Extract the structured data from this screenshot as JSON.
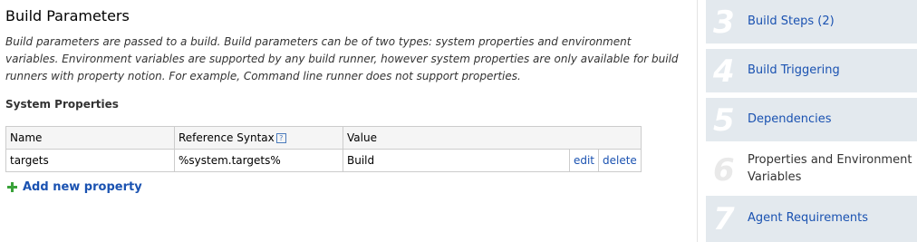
{
  "build_parameters": {
    "title": "Build Parameters",
    "description": "Build parameters are passed to a build. Build parameters can be of two types: system properties and environment variables. Environment variables are supported by any build runner, however system properties are only available for build runners with property notion. For example, Command line runner does not support properties.",
    "desc_lines": [
      "Build parameters are passed to a build. Build parameters can be of two types: system properties and environment",
      "variables. Environment variables are supported by any build runner, however system properties are only available for build",
      "runners with property notion. For example, Command line runner does not support properties."
    ]
  },
  "system_properties": {
    "title": "System Properties",
    "columns": {
      "name": "Name",
      "reference": "Reference Syntax",
      "value": "Value"
    },
    "help_icon": "help-icon",
    "rows": [
      {
        "name": "targets",
        "reference": "%system.targets%",
        "value": "Build",
        "edit": "edit",
        "delete": "delete"
      }
    ],
    "add_label": "Add new property",
    "add_icon": "plus-icon"
  },
  "steps": [
    {
      "number": "3",
      "label": "Build Steps (2)",
      "current": false
    },
    {
      "number": "4",
      "label": "Build Triggering",
      "current": false
    },
    {
      "number": "5",
      "label": "Dependencies",
      "current": false
    },
    {
      "number": "6",
      "label_lines": [
        "Properties and Environment",
        "Variables"
      ],
      "current": true
    },
    {
      "number": "7",
      "label": "Agent Requirements",
      "current": false
    }
  ],
  "colors": {
    "link": "#1a52b1",
    "step_bg": "#e3e9ee",
    "add_icon": "#3aa23a"
  }
}
